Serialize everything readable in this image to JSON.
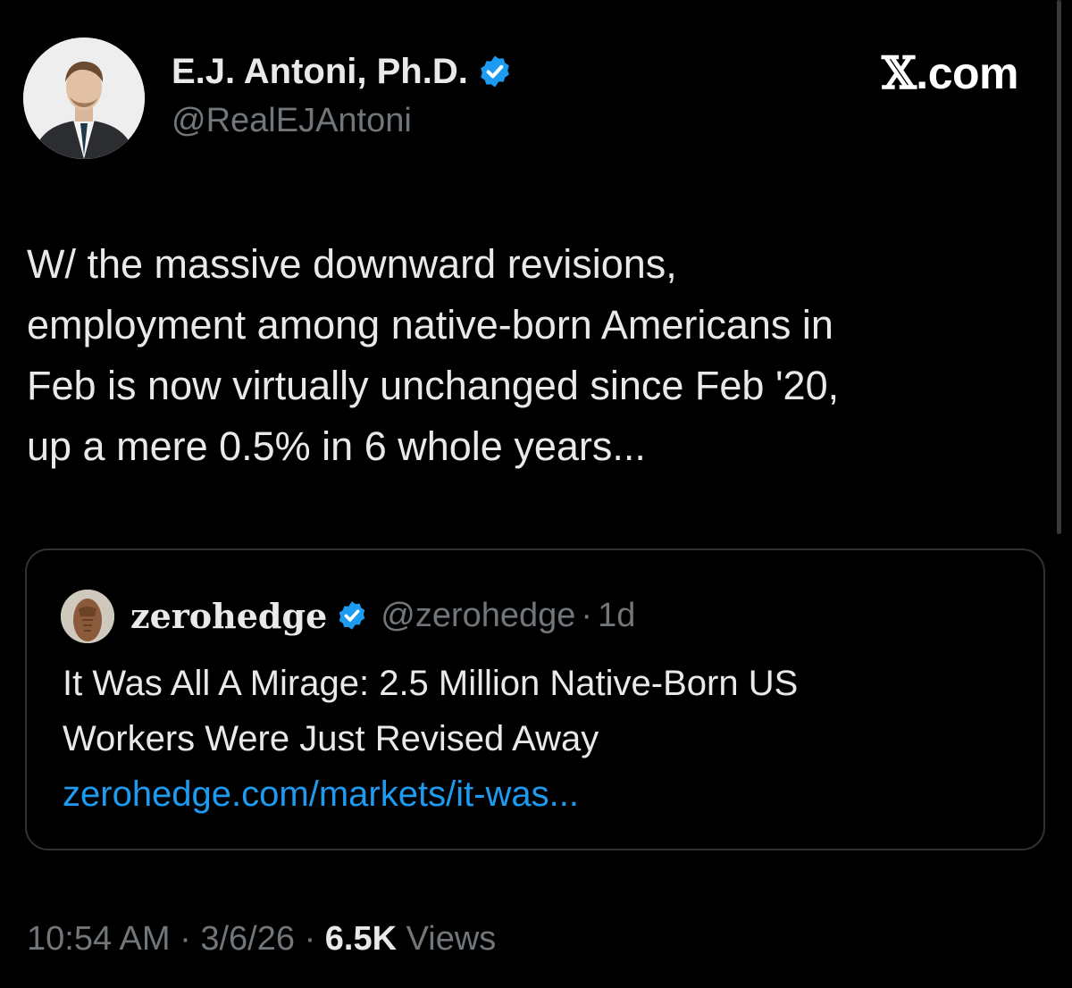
{
  "author": {
    "display_name": "E.J. Antoni, Ph.D.",
    "handle": "@RealEJAntoni",
    "verified_icon": "verified-badge-icon",
    "avatar_icon": "profile-photo-avatar"
  },
  "site": {
    "x_glyph": "𝕏",
    "suffix": ".com"
  },
  "tweet": {
    "lines": [
      "W/ the massive downward revisions,",
      "employment among native-born Americans in",
      "Feb is now virtually unchanged since Feb '20,",
      "up a mere 0.5% in 6 whole years..."
    ]
  },
  "quote": {
    "display_name": "zerohedge",
    "handle": "@zerohedge",
    "separator": "·",
    "age": "1d",
    "text_lines": [
      "It Was All A Mirage: 2.5 Million Native-Born US",
      "Workers Were Just Revised Away"
    ],
    "link": "zerohedge.com/markets/it-was..."
  },
  "footer": {
    "time": "10:54 AM",
    "separator": "·",
    "date": "3/6/26",
    "views_count": "6.5K",
    "views_label": "Views"
  },
  "colors": {
    "background": "#000000",
    "text": "#e7e9ea",
    "secondary": "#71767b",
    "link": "#1d9bf0",
    "verified": "#1d9bf0",
    "border": "#2f3336"
  }
}
